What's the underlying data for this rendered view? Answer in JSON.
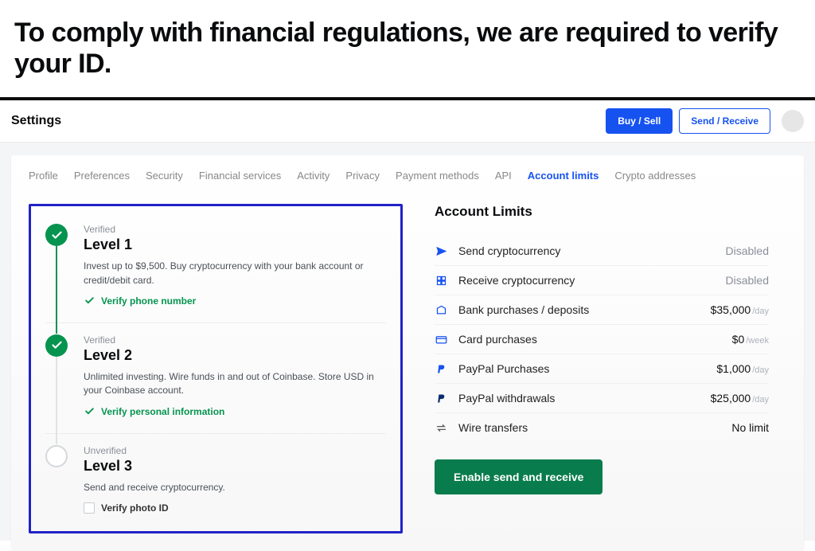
{
  "banner": {
    "heading": "To comply with financial regulations, we are required to verify your ID."
  },
  "topbar": {
    "title": "Settings",
    "buy_sell": "Buy / Sell",
    "send_receive": "Send / Receive"
  },
  "tabs": [
    {
      "label": "Profile",
      "active": false
    },
    {
      "label": "Preferences",
      "active": false
    },
    {
      "label": "Security",
      "active": false
    },
    {
      "label": "Financial services",
      "active": false
    },
    {
      "label": "Activity",
      "active": false
    },
    {
      "label": "Privacy",
      "active": false
    },
    {
      "label": "Payment methods",
      "active": false
    },
    {
      "label": "API",
      "active": false
    },
    {
      "label": "Account limits",
      "active": true
    },
    {
      "label": "Crypto addresses",
      "active": false
    }
  ],
  "levels": [
    {
      "status": "Verified",
      "name": "Level 1",
      "desc": "Invest up to $9,500. Buy cryptocurrency with your bank account or credit/debit card.",
      "action": "Verify phone number",
      "done": true
    },
    {
      "status": "Verified",
      "name": "Level 2",
      "desc": "Unlimited investing. Wire funds in and out of Coinbase. Store USD in your Coinbase account.",
      "action": "Verify personal information",
      "done": true
    },
    {
      "status": "Unverified",
      "name": "Level 3",
      "desc": "Send and receive cryptocurrency.",
      "action": "Verify photo ID",
      "done": false
    }
  ],
  "limits": {
    "heading": "Account Limits",
    "rows": [
      {
        "icon": "send",
        "label": "Send cryptocurrency",
        "value": "Disabled",
        "per": ""
      },
      {
        "icon": "receive",
        "label": "Receive cryptocurrency",
        "value": "Disabled",
        "per": ""
      },
      {
        "icon": "bank",
        "label": "Bank purchases / deposits",
        "value": "$35,000",
        "per": "/day"
      },
      {
        "icon": "card",
        "label": "Card purchases",
        "value": "$0",
        "per": "/week"
      },
      {
        "icon": "paypal",
        "label": "PayPal Purchases",
        "value": "$1,000",
        "per": "/day"
      },
      {
        "icon": "paypal-dark",
        "label": "PayPal withdrawals",
        "value": "$25,000",
        "per": "/day"
      },
      {
        "icon": "wire",
        "label": "Wire transfers",
        "value": "No limit",
        "per": ""
      }
    ],
    "cta": "Enable send and receive"
  },
  "colors": {
    "primary_blue": "#1652f0",
    "highlight_border": "#2022c7",
    "success_green": "#05944f",
    "cta_green": "#087c4c"
  }
}
